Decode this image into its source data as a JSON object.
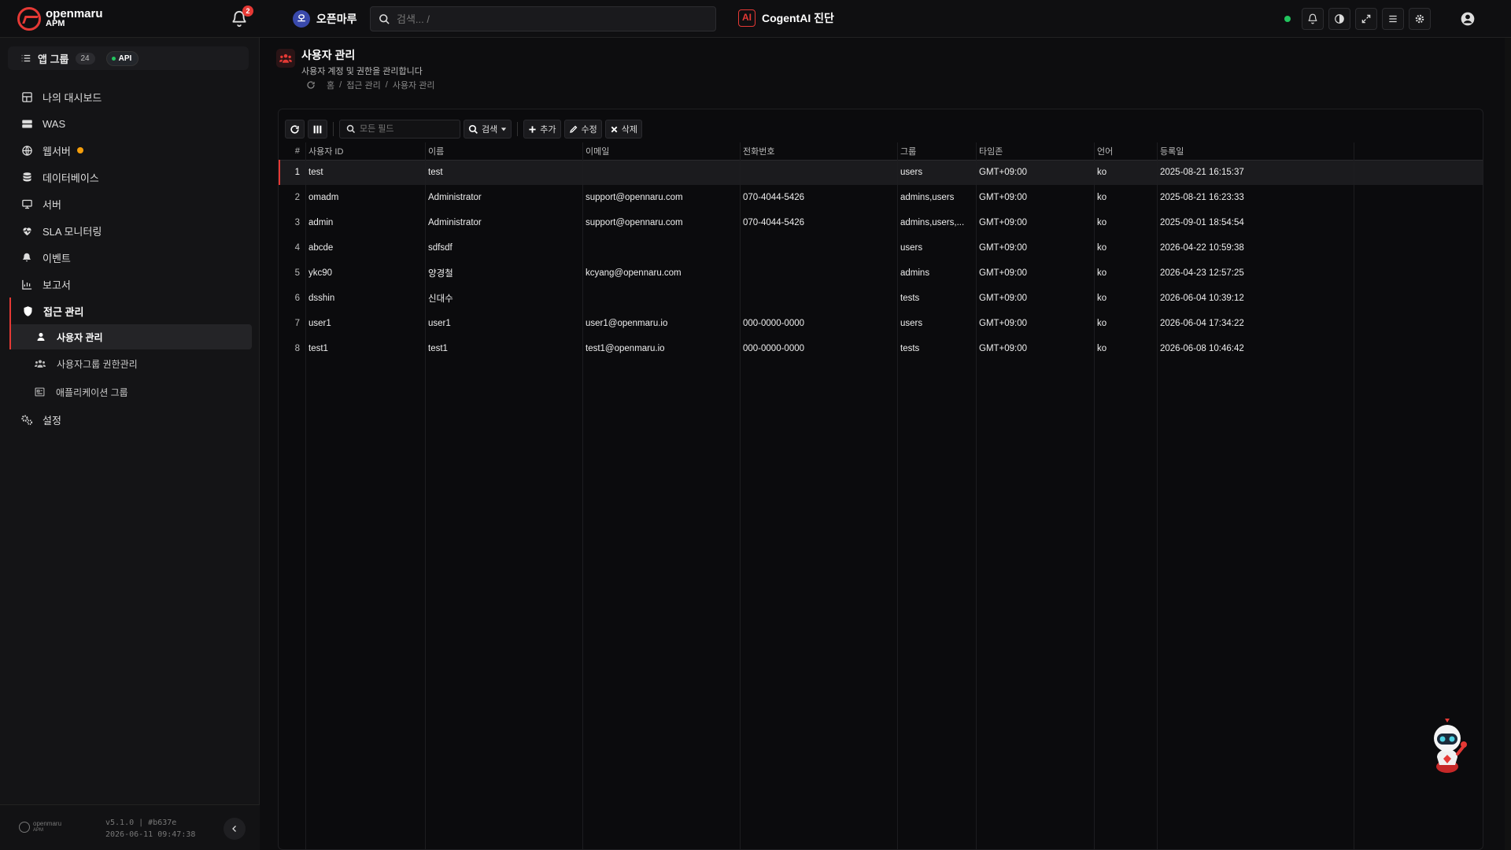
{
  "app": {
    "logo_top": "openmaru",
    "logo_bottom": "APM",
    "notification_count": "2",
    "org_avatar": "오",
    "org_name": "오픈마루",
    "search_placeholder": "검색... /",
    "ai_icon": "AI",
    "ai_label": "CogentAI 진단",
    "status_color": "#22c55e"
  },
  "topbar_icons": [
    "bell-icon",
    "contrast-icon",
    "fullscreen-icon",
    "menu-icon",
    "settings-icon",
    "user-circle-icon"
  ],
  "sidebar": {
    "app_group_label": "앱 그룹",
    "app_group_count": "24",
    "api_label": "API",
    "items": [
      {
        "label": "나의 대시보드",
        "icon": "dashboard-icon"
      },
      {
        "label": "WAS",
        "icon": "server-stack-icon"
      },
      {
        "label": "웹서버",
        "icon": "globe-icon"
      },
      {
        "label": "데이터베이스",
        "icon": "database-icon"
      },
      {
        "label": "서버",
        "icon": "monitor-icon"
      },
      {
        "label": "SLA 모니터링",
        "icon": "heartbeat-icon"
      },
      {
        "label": "이벤트",
        "icon": "bell-icon"
      },
      {
        "label": "보고서",
        "icon": "chart-icon"
      },
      {
        "label": "접근 관리",
        "icon": "shield-icon"
      }
    ],
    "sub_items": [
      {
        "label": "사용자 관리",
        "icon": "user-icon"
      },
      {
        "label": "사용자그룹 권한관리",
        "icon": "users-icon"
      },
      {
        "label": "애플리케이션 그룹",
        "icon": "app-group-icon"
      }
    ],
    "settings_label": "설정",
    "footer_logo_top": "openmaru",
    "footer_logo_bottom": "APM",
    "version": "v5.1.0 | #b637e",
    "build_date": "2026-06-11 09:47:38"
  },
  "page": {
    "title": "사용자 관리",
    "subtitle": "사용자 계정 및 권한을 관리합니다",
    "breadcrumb": [
      "홈",
      "접근 관리",
      "사용자 관리"
    ],
    "breadcrumb_sep": "/"
  },
  "toolbar": {
    "search_placeholder": "모든 필드",
    "search_label": "검색",
    "add_label": "추가",
    "edit_label": "수정",
    "delete_label": "삭제"
  },
  "table": {
    "columns": [
      "#",
      "사용자 ID",
      "이름",
      "이메일",
      "전화번호",
      "그룹",
      "타임존",
      "언어",
      "등록일"
    ],
    "rows": [
      [
        "1",
        "test",
        "test",
        "",
        "",
        "users",
        "GMT+09:00",
        "ko",
        "2025-08-21 16:15:37"
      ],
      [
        "2",
        "omadm",
        "Administrator",
        "support@opennaru.com",
        "070-4044-5426",
        "admins,users",
        "GMT+09:00",
        "ko",
        "2025-08-21 16:23:33"
      ],
      [
        "3",
        "admin",
        "Administrator",
        "support@opennaru.com",
        "070-4044-5426",
        "admins,users,...",
        "GMT+09:00",
        "ko",
        "2025-09-01 18:54:54"
      ],
      [
        "4",
        "abcde",
        "sdfsdf",
        "",
        "",
        "users",
        "GMT+09:00",
        "ko",
        "2026-04-22 10:59:38"
      ],
      [
        "5",
        "ykc90",
        "양경철",
        "kcyang@opennaru.com",
        "",
        "admins",
        "GMT+09:00",
        "ko",
        "2026-04-23 12:57:25"
      ],
      [
        "6",
        "dsshin",
        "신대수",
        "",
        "",
        "tests",
        "GMT+09:00",
        "ko",
        "2026-06-04 10:39:12"
      ],
      [
        "7",
        "user1",
        "user1",
        "user1@openmaru.io",
        "000-0000-0000",
        "users",
        "GMT+09:00",
        "ko",
        "2026-06-04 17:34:22"
      ],
      [
        "8",
        "test1",
        "test1",
        "test1@openmaru.io",
        "000-0000-0000",
        "tests",
        "GMT+09:00",
        "ko",
        "2026-06-08 10:46:42"
      ]
    ],
    "selected_row": 0
  }
}
